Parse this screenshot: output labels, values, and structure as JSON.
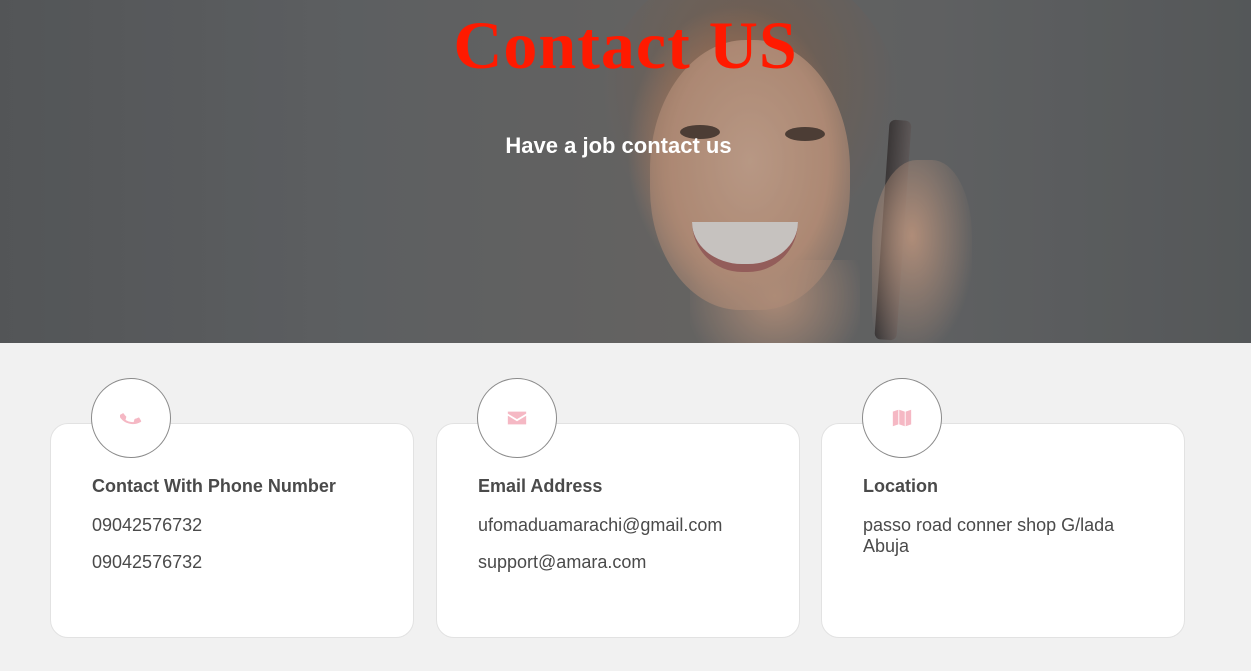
{
  "hero": {
    "title": "Contact US",
    "subtitle": "Have a job contact us"
  },
  "colors": {
    "title": "#ff1a00",
    "icon": "#f5b8c4",
    "card_text": "#4a4a4a"
  },
  "cards": [
    {
      "icon": "phone-icon",
      "title": "Contact With Phone Number",
      "lines": [
        "09042576732",
        "09042576732"
      ]
    },
    {
      "icon": "envelope-icon",
      "title": "Email Address",
      "lines": [
        "ufomaduamarachi@gmail.com",
        "support@amara.com"
      ]
    },
    {
      "icon": "map-icon",
      "title": "Location",
      "lines": [
        "passo road conner shop G/lada Abuja"
      ]
    }
  ]
}
